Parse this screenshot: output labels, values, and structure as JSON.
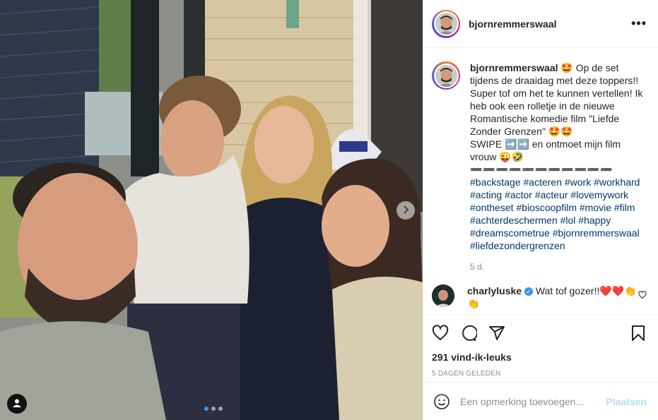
{
  "post": {
    "username": "bjornremmerswaal",
    "more_label": "•••",
    "caption": {
      "username": "bjornremmerswaal",
      "text_line1": " 🤩 Op de set tijdens de draaidag met deze toppers!! Super tof om het te kunnen vertellen! Ik heb ook een rolletje in de nieuwe Romantische komedie film \"Liefde Zonder Grenzen\" 🤩🤩",
      "text_line2": "SWIPE ➡️➡️ en ontmoet mijn film vrouw 😜🤣",
      "dashes": "➖➖➖➖➖➖➖➖➖➖➖",
      "hashtags": "#backstage #acteren #work #workhard #acting #actor #acteur #lovemywork #ontheset #bioscoopfilm #movie #film #achterdeschermen #lol #happy #dreamscometrue #bjornremmerswaal #liefdezondergrenzen",
      "age": "5 d."
    },
    "comment": {
      "username": "charlyluske",
      "verified_mark": "✓",
      "text": " Wat tof gozer!!❤️❤️👏👏"
    },
    "likes": "291 vind-ik-leuks",
    "date": "5 DAGEN GELEDEN",
    "add_comment": {
      "placeholder": "Een opmerking toevoegen...",
      "post_label": "Plaatsen"
    },
    "carousel": {
      "count": 3,
      "active_index": 0
    }
  },
  "icons": {
    "like": "heart-icon",
    "comment": "comment-icon",
    "share": "share-icon",
    "save": "bookmark-icon",
    "emoji": "emoji-icon",
    "next": "chevron-right-icon",
    "tags": "user-icon"
  },
  "colors": {
    "link": "#00376b",
    "muted": "#8e8e8e",
    "post_button_disabled": "#b2dffc",
    "verified": "#3897f0"
  }
}
